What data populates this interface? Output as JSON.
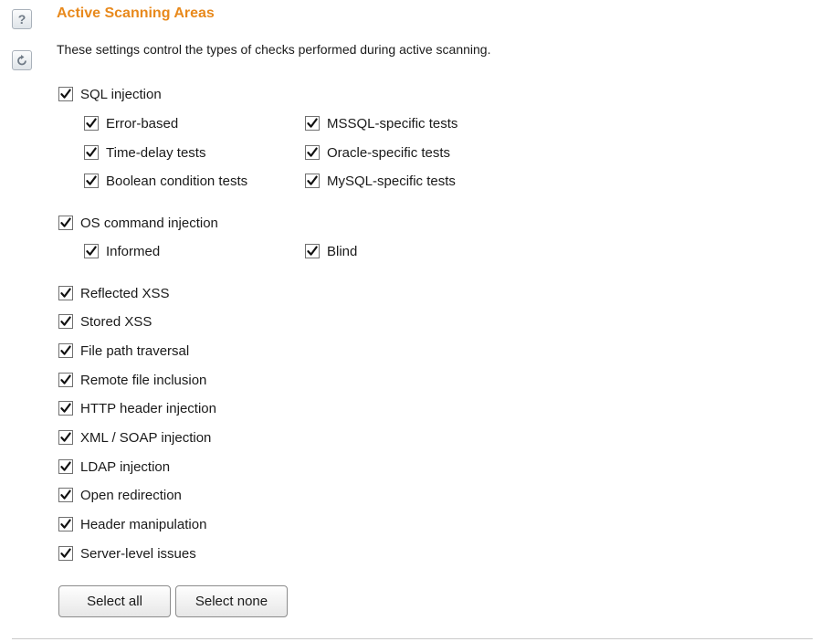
{
  "header": {
    "help_glyph": "?",
    "title": "Active Scanning Areas",
    "description": "These settings control the types of checks performed during active scanning."
  },
  "sql": {
    "label": "SQL injection",
    "checked": true,
    "sub": [
      {
        "label": "Error-based",
        "checked": true
      },
      {
        "label": "Time-delay tests",
        "checked": true
      },
      {
        "label": "Boolean condition tests",
        "checked": true
      },
      {
        "label": "MSSQL-specific tests",
        "checked": true
      },
      {
        "label": "Oracle-specific tests",
        "checked": true
      },
      {
        "label": "MySQL-specific tests",
        "checked": true
      }
    ]
  },
  "os": {
    "label": "OS command injection",
    "checked": true,
    "sub": [
      {
        "label": "Informed",
        "checked": true
      },
      {
        "label": "Blind",
        "checked": true
      }
    ]
  },
  "checks": [
    {
      "label": "Reflected XSS",
      "checked": true
    },
    {
      "label": "Stored XSS",
      "checked": true
    },
    {
      "label": "File path traversal",
      "checked": true
    },
    {
      "label": "Remote file inclusion",
      "checked": true
    },
    {
      "label": "HTTP header injection",
      "checked": true
    },
    {
      "label": "XML / SOAP injection",
      "checked": true
    },
    {
      "label": "LDAP injection",
      "checked": true
    },
    {
      "label": "Open redirection",
      "checked": true
    },
    {
      "label": "Header manipulation",
      "checked": true
    },
    {
      "label": "Server-level issues",
      "checked": true
    }
  ],
  "buttons": {
    "select_all": "Select all",
    "select_none": "Select none"
  },
  "colors": {
    "accent": "#e8891c",
    "checkmark": "#111111"
  }
}
